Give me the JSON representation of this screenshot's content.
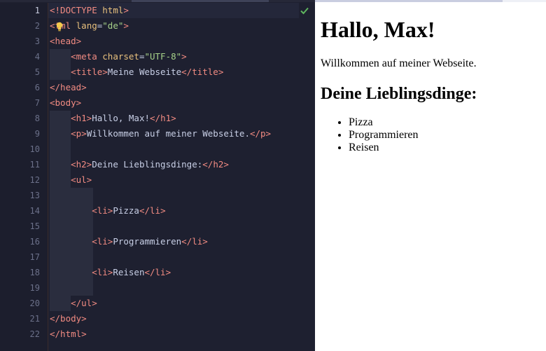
{
  "editor": {
    "line_numbers": [
      "1",
      "2",
      "3",
      "4",
      "5",
      "6",
      "7",
      "8",
      "9",
      "10",
      "11",
      "12",
      "13",
      "14",
      "15",
      "16",
      "17",
      "18",
      "19",
      "20",
      "21",
      "22"
    ],
    "lines": [
      {
        "segments": [
          [
            "tag",
            "<!DOCTYPE "
          ],
          [
            "attr",
            "html"
          ],
          [
            "tag",
            ">"
          ]
        ]
      },
      {
        "segments": [
          [
            "tag",
            "<"
          ],
          [
            "tag",
            "tml "
          ],
          [
            "attr",
            "lang"
          ],
          [
            "txt",
            "="
          ],
          [
            "str",
            "\"de\""
          ],
          [
            "tag",
            ">"
          ]
        ]
      },
      {
        "segments": [
          [
            "tag",
            "<head>"
          ]
        ]
      },
      {
        "segments": [
          [
            "txt",
            "    "
          ],
          [
            "tag",
            "<meta "
          ],
          [
            "attr",
            "charset"
          ],
          [
            "txt",
            "="
          ],
          [
            "str",
            "\"UTF-8\""
          ],
          [
            "tag",
            ">"
          ]
        ]
      },
      {
        "segments": [
          [
            "txt",
            "    "
          ],
          [
            "tag",
            "<title>"
          ],
          [
            "txt",
            "Meine Webseite"
          ],
          [
            "tag",
            "</title>"
          ]
        ]
      },
      {
        "segments": [
          [
            "tag",
            "</head>"
          ]
        ]
      },
      {
        "segments": [
          [
            "tag",
            "<body>"
          ]
        ]
      },
      {
        "segments": [
          [
            "txt",
            "    "
          ],
          [
            "tag",
            "<h1>"
          ],
          [
            "txt",
            "Hallo, Max!"
          ],
          [
            "tag",
            "</h1>"
          ]
        ]
      },
      {
        "segments": [
          [
            "txt",
            "    "
          ],
          [
            "tag",
            "<p>"
          ],
          [
            "txt",
            "Willkommen auf meiner Webseite."
          ],
          [
            "tag",
            "</p>"
          ]
        ]
      },
      {
        "segments": []
      },
      {
        "segments": [
          [
            "txt",
            "    "
          ],
          [
            "tag",
            "<h2>"
          ],
          [
            "txt",
            "Deine Lieblingsdinge:"
          ],
          [
            "tag",
            "</h2>"
          ]
        ]
      },
      {
        "segments": [
          [
            "txt",
            "    "
          ],
          [
            "tag",
            "<ul>"
          ]
        ]
      },
      {
        "segments": []
      },
      {
        "segments": [
          [
            "txt",
            "        "
          ],
          [
            "tag",
            "<li>"
          ],
          [
            "txt",
            "Pizza"
          ],
          [
            "tag",
            "</li>"
          ]
        ]
      },
      {
        "segments": []
      },
      {
        "segments": [
          [
            "txt",
            "        "
          ],
          [
            "tag",
            "<li>"
          ],
          [
            "txt",
            "Programmieren"
          ],
          [
            "tag",
            "</li>"
          ]
        ]
      },
      {
        "segments": []
      },
      {
        "segments": [
          [
            "txt",
            "        "
          ],
          [
            "tag",
            "<li>"
          ],
          [
            "txt",
            "Reisen"
          ],
          [
            "tag",
            "</li>"
          ]
        ]
      },
      {
        "segments": []
      },
      {
        "segments": [
          [
            "txt",
            "    "
          ],
          [
            "tag",
            "</ul>"
          ]
        ]
      },
      {
        "segments": [
          [
            "tag",
            "</body>"
          ]
        ]
      },
      {
        "segments": [
          [
            "tag",
            "</html>"
          ]
        ]
      }
    ],
    "status_icon": "check-icon",
    "hint_icon": "lightbulb-icon",
    "colors": {
      "tag": "#f28b82",
      "attr": "#e8c07d",
      "string": "#a6d189",
      "text": "#c8cfe6",
      "background": "#1e2030",
      "check": "#5fb65f"
    }
  },
  "preview": {
    "heading": "Hallo, Max!",
    "paragraph": "Willkommen auf meiner Webseite.",
    "subheading": "Deine Lieblingsdinge:",
    "list_items": [
      "Pizza",
      "Programmieren",
      "Reisen"
    ]
  }
}
